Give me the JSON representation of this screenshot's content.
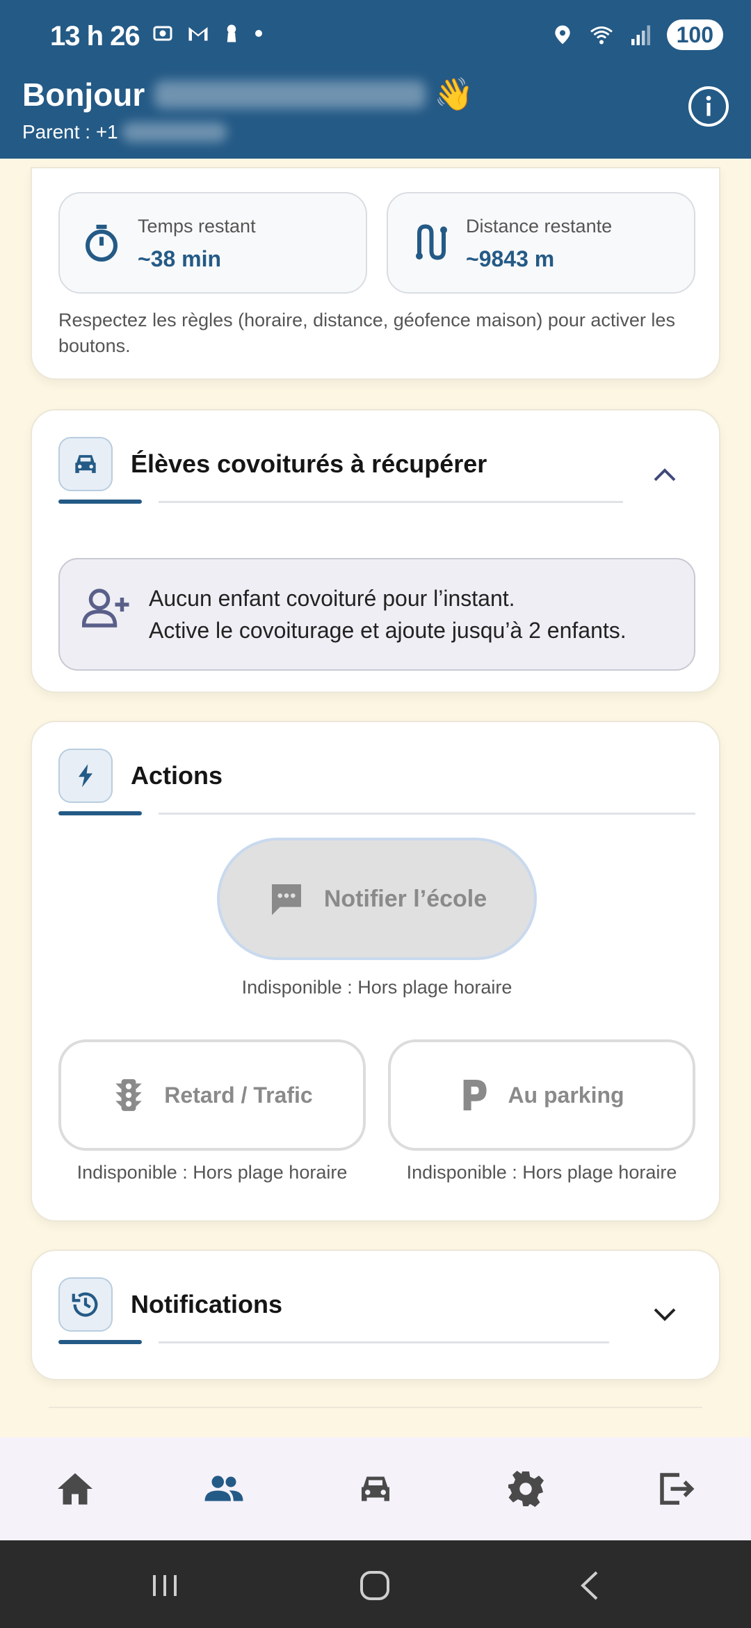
{
  "status_bar": {
    "time": "13 h 26",
    "battery": "100"
  },
  "header": {
    "greeting": "Bonjour",
    "emoji": "👋",
    "subtitle_prefix": "Parent : +1"
  },
  "trip": {
    "time_label": "Temps restant",
    "time_value": "~38 min",
    "distance_label": "Distance restante",
    "distance_value": "~9843 m",
    "rules_text": "Respectez les règles (horaire, distance, géofence maison) pour activer les boutons."
  },
  "carpool": {
    "title": "Élèves covoiturés à récupérer",
    "empty_line1": "Aucun enfant covoituré pour l’instant.",
    "empty_line2": "Active le covoiturage et ajoute jusqu’à 2 enfants."
  },
  "actions": {
    "title": "Actions",
    "notify_label": "Notifier l’école",
    "notify_hint": "Indisponible : Hors plage horaire",
    "retard_label": "Retard / Trafic",
    "retard_hint": "Indisponible : Hors plage horaire",
    "parking_label": "Au parking",
    "parking_hint": "Indisponible : Hors plage horaire"
  },
  "notifications": {
    "title": "Notifications"
  },
  "bottom_nav": {
    "active": "users",
    "active_color": "#245a86",
    "inactive_color": "#4a4a4a"
  },
  "colors": {
    "primary": "#245a86",
    "background": "#fdf6e3"
  }
}
